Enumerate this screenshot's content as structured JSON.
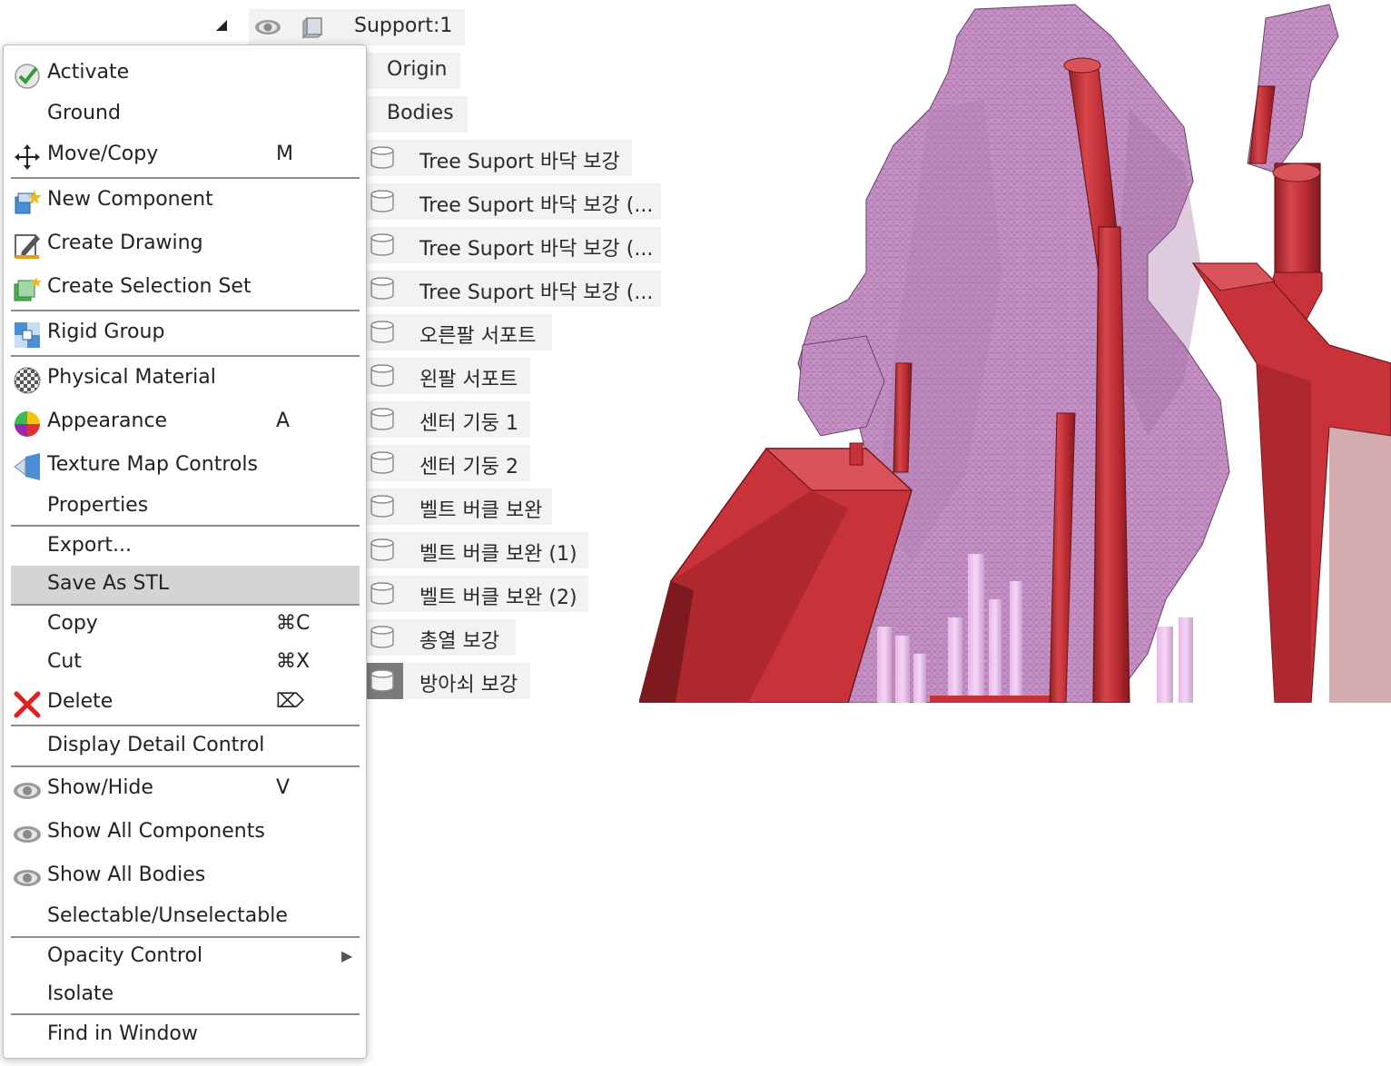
{
  "browser": {
    "root_label": "Support:1",
    "folders": [
      "Origin",
      "Bodies"
    ],
    "bodies": [
      "Tree Suport 바닥 보강",
      "Tree Suport 바닥 보강 (...",
      "Tree Suport 바닥 보강 (...",
      "Tree Suport 바닥 보강 (...",
      "오른팔 서포트",
      "왼팔 서포트",
      "센터 기둥 1",
      "센터 기둥 2",
      "벨트 버클 보완",
      "벨트 버클 보완 (1)",
      "벨트 버클 보완 (2)",
      "총열 보강",
      "방아쇠 보강"
    ]
  },
  "context_menu": {
    "items": [
      {
        "label": "Activate",
        "shortcut": "",
        "icon": "checkmark-icon"
      },
      {
        "label": "Ground",
        "shortcut": "",
        "icon": ""
      },
      {
        "label": "Move/Copy",
        "shortcut": "M",
        "icon": "move-arrows-icon"
      },
      {
        "label": "New Component",
        "shortcut": "",
        "icon": "new-component-icon"
      },
      {
        "label": "Create Drawing",
        "shortcut": "",
        "icon": "drawing-icon"
      },
      {
        "label": "Create Selection Set",
        "shortcut": "",
        "icon": "selection-set-icon"
      },
      {
        "label": "Rigid Group",
        "shortcut": "",
        "icon": "rigid-group-icon"
      },
      {
        "label": "Physical Material",
        "shortcut": "",
        "icon": "checker-ball-icon"
      },
      {
        "label": "Appearance",
        "shortcut": "A",
        "icon": "color-wheel-icon"
      },
      {
        "label": "Texture Map Controls",
        "shortcut": "",
        "icon": "texture-map-icon"
      },
      {
        "label": "Properties",
        "shortcut": "",
        "icon": ""
      },
      {
        "label": "Export...",
        "shortcut": "",
        "icon": ""
      },
      {
        "label": "Save As STL",
        "shortcut": "",
        "icon": ""
      },
      {
        "label": "Copy",
        "shortcut": "⌘C",
        "icon": ""
      },
      {
        "label": "Cut",
        "shortcut": "⌘X",
        "icon": ""
      },
      {
        "label": "Delete",
        "shortcut": "⌦",
        "icon": "red-x-icon"
      },
      {
        "label": "Display Detail Control",
        "shortcut": "",
        "icon": ""
      },
      {
        "label": "Show/Hide",
        "shortcut": "V",
        "icon": "eye-icon"
      },
      {
        "label": "Show All Components",
        "shortcut": "",
        "icon": "eye-icon"
      },
      {
        "label": "Show All Bodies",
        "shortcut": "",
        "icon": "eye-icon"
      },
      {
        "label": "Selectable/Unselectable",
        "shortcut": "",
        "icon": ""
      },
      {
        "label": "Opacity Control",
        "shortcut": "▶",
        "icon": ""
      },
      {
        "label": "Isolate",
        "shortcut": "",
        "icon": ""
      },
      {
        "label": "Find in Window",
        "shortcut": "",
        "icon": ""
      }
    ],
    "highlighted": "Save As STL"
  },
  "colors": {
    "menu_highlight": "#d4d4d4",
    "row_bg": "#f2f2f2",
    "mesh": "#c98ec7",
    "support": "#c8333a"
  }
}
